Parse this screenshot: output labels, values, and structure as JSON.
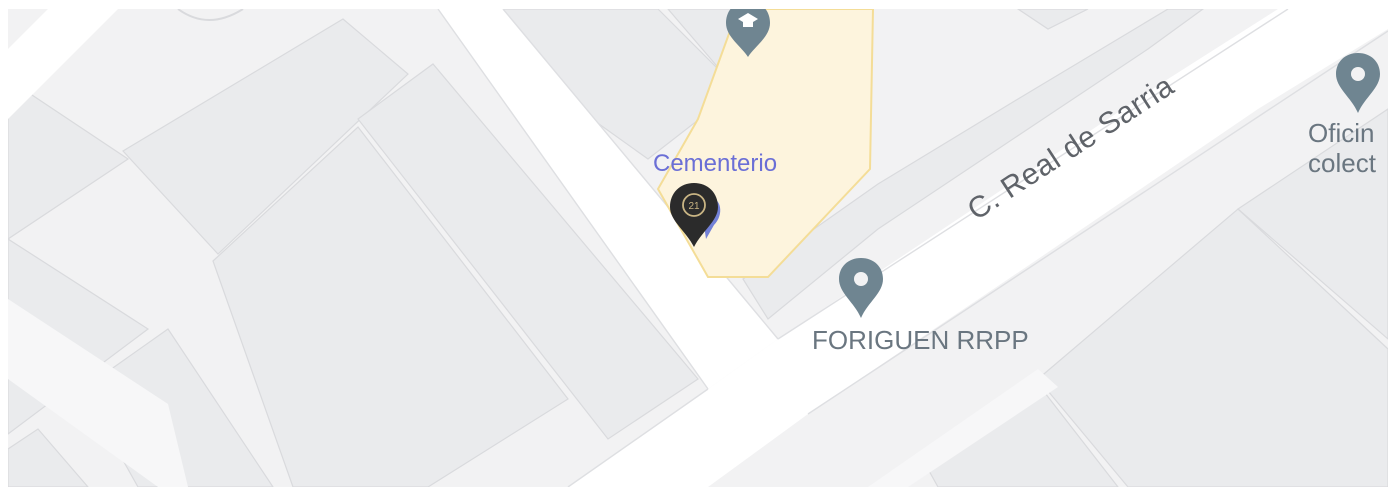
{
  "map": {
    "street_name": "C. Real de Sarria",
    "places": {
      "cemetery": {
        "label": "Cementerio",
        "icon": "cemetery-area"
      },
      "foriguen": {
        "label": "FORIGUEN RRPP",
        "icon": "place-pin-icon"
      },
      "office": {
        "label_line1": "Oficin",
        "label_line2": "colect",
        "icon": "place-pin-icon"
      },
      "school": {
        "icon": "graduation-cap-icon"
      }
    },
    "listing_marker": {
      "badge_text": "21",
      "icon": "century21-marker-icon"
    },
    "colors": {
      "background": "#f2f2f3",
      "block": "#e9eaec",
      "road": "#ffffff",
      "cemetery_fill": "#fdf4dd",
      "cemetery_stroke": "#f4dd97",
      "pin": "#6f8591",
      "listing_marker": "#2b2b2b",
      "listing_accent": "#c9b584",
      "cemetery_text": "#6b6fd6"
    }
  }
}
